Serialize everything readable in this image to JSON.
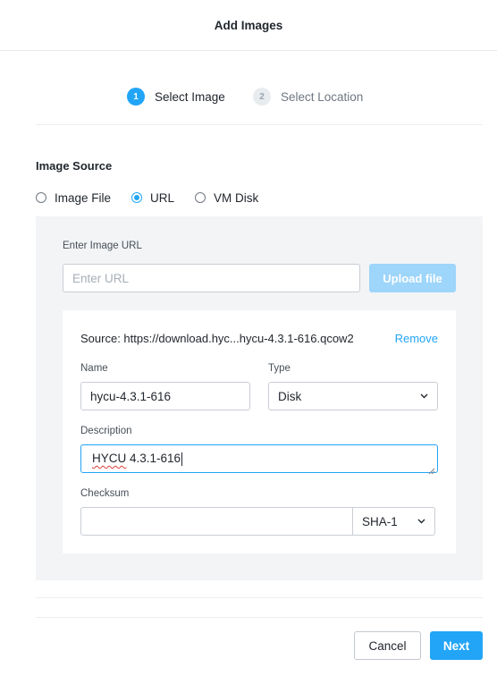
{
  "dialog": {
    "title": "Add Images"
  },
  "steps": [
    {
      "number": "1",
      "label": "Select Image",
      "active": true
    },
    {
      "number": "2",
      "label": "Select Location",
      "active": false
    }
  ],
  "image_source": {
    "title": "Image Source",
    "options": [
      {
        "label": "Image File",
        "checked": false
      },
      {
        "label": "URL",
        "checked": true
      },
      {
        "label": "VM Disk",
        "checked": false
      }
    ]
  },
  "url_panel": {
    "label": "Enter Image URL",
    "placeholder": "Enter URL",
    "upload_label": "Upload file"
  },
  "image_card": {
    "source": "Source: https://download.hyc...hycu-4.3.1-616.qcow2",
    "remove_label": "Remove",
    "name_label": "Name",
    "name_value": "hycu-4.3.1-616",
    "type_label": "Type",
    "type_value": "Disk",
    "description_label": "Description",
    "description_value_word": "HYCU",
    "description_value_rest": " 4.3.1-616",
    "checksum_label": "Checksum",
    "checksum_value": "",
    "checksum_algorithm": "SHA-1"
  },
  "footer": {
    "cancel_label": "Cancel",
    "next_label": "Next"
  },
  "colors": {
    "accent": "#22a5f7",
    "accent_disabled": "#9ed5fa",
    "panel_bg": "#f2f4f6",
    "spellcheck": "#e0413a"
  },
  "icons": {
    "select_arrow": "chevron-down-icon",
    "textarea_resize": "resize-handle-icon"
  }
}
